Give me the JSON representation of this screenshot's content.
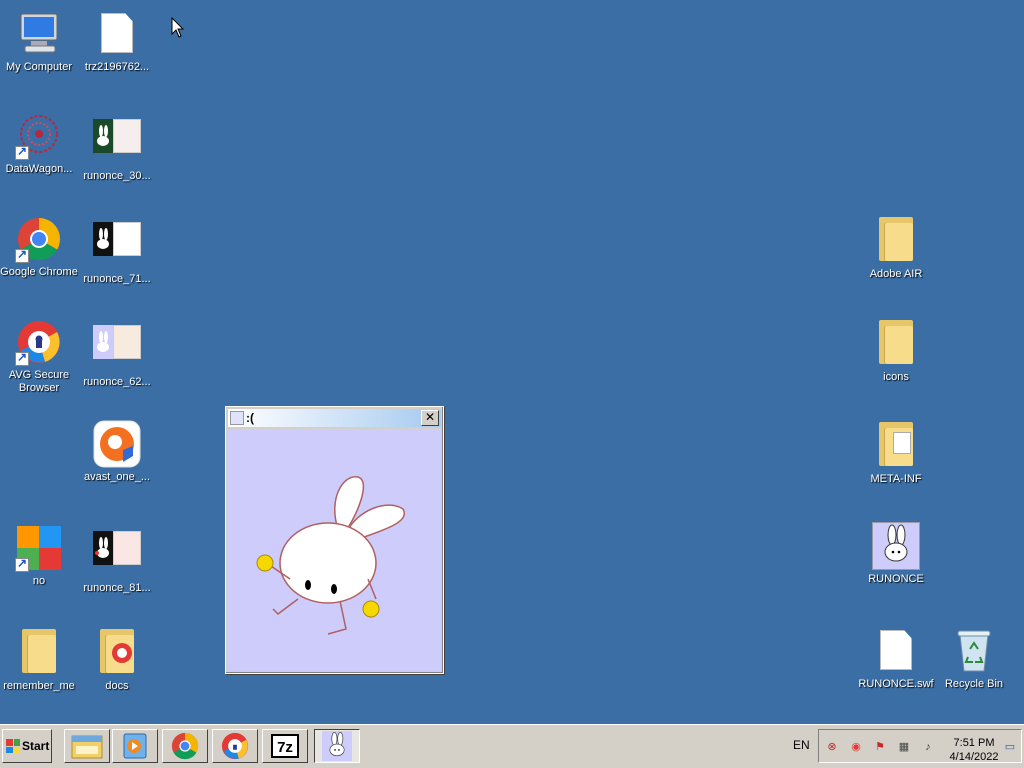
{
  "desktop": {
    "left_icons": [
      {
        "label": "My Computer",
        "icon": "my-computer-icon"
      },
      {
        "label": "trz2196762...",
        "icon": "blank-file-icon"
      },
      {
        "label": "DataWagon...",
        "icon": "datawagon-icon"
      },
      {
        "label": "runonce_30...",
        "icon": "image-thumbnail-icon"
      },
      {
        "label": "Google Chrome",
        "icon": "chrome-icon"
      },
      {
        "label": "runonce_71...",
        "icon": "image-thumbnail-icon"
      },
      {
        "label": "AVG Secure Browser",
        "icon": "avg-secure-browser-icon"
      },
      {
        "label": "runonce_62...",
        "icon": "image-thumbnail-icon"
      },
      {
        "label": "avast_one_...",
        "icon": "avast-icon"
      },
      {
        "label": "no",
        "icon": "avg-icon"
      },
      {
        "label": "runonce_81...",
        "icon": "image-thumbnail-icon"
      },
      {
        "label": "remember_me",
        "icon": "folder-icon"
      },
      {
        "label": "docs",
        "icon": "folder-icon"
      }
    ],
    "right_icons": [
      {
        "label": "Adobe AIR",
        "icon": "folder-icon"
      },
      {
        "label": "icons",
        "icon": "folder-icon"
      },
      {
        "label": "META-INF",
        "icon": "folder-icon"
      },
      {
        "label": "RUNONCE",
        "icon": "bunny-icon"
      },
      {
        "label": "RUNONCE.swf",
        "icon": "blank-file-icon"
      },
      {
        "label": "Recycle Bin",
        "icon": "recycle-bin-icon"
      }
    ]
  },
  "window": {
    "title": ":(",
    "close_label": "✕"
  },
  "taskbar": {
    "start_label": "Start",
    "buttons": [
      "file-explorer-icon",
      "media-player-icon",
      "chrome-icon",
      "avg-secure-browser-icon",
      "7zip-icon",
      "bunny-icon"
    ],
    "language": "EN",
    "time": "7:51 PM",
    "date": "4/14/2022"
  },
  "colors": {
    "desktop": "#3a6ea5",
    "window_body": "#cdccfb",
    "taskbar": "#d4d0c8"
  }
}
